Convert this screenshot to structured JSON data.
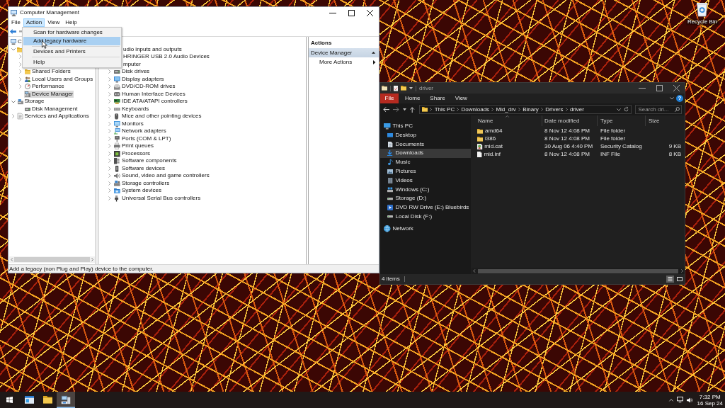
{
  "desktop": {
    "recycle_bin": {
      "label": "Recycle Bin"
    }
  },
  "computer_management": {
    "title": "Computer Management",
    "menu_bar": [
      {
        "label": "File",
        "selected": false
      },
      {
        "label": "Action",
        "selected": true
      },
      {
        "label": "View",
        "selected": false
      },
      {
        "label": "Help",
        "selected": false
      }
    ],
    "action_menu": [
      {
        "kind": "item",
        "label": "Scan for hardware changes",
        "selected": false
      },
      {
        "kind": "item",
        "label": "Add legacy hardware",
        "selected": true
      },
      {
        "kind": "separator"
      },
      {
        "kind": "item",
        "label": "Devices and Printers",
        "selected": false
      },
      {
        "kind": "separator"
      },
      {
        "kind": "item",
        "label": "Help",
        "selected": false
      }
    ],
    "console_tree": [
      {
        "kind": "computer",
        "label": "C",
        "selected": false,
        "children": [
          {
            "kind": "tools",
            "expanded": true,
            "children": [
              {
                "kind": "covered",
                "expanded": false
              },
              {
                "kind": "covered",
                "expanded": false
              },
              {
                "kind": "shared",
                "label": "Shared Folders",
                "expanded": false,
                "selected": false
              },
              {
                "kind": "users",
                "label": "Local Users and Groups",
                "expanded": false,
                "selected": false
              },
              {
                "kind": "performance",
                "label": "Performance",
                "expanded": false,
                "selected": false
              },
              {
                "kind": "device_manager",
                "label": "Device Manager",
                "selected": true
              }
            ]
          },
          {
            "kind": "storage",
            "label": "Storage",
            "expanded": true,
            "selected": false,
            "children": [
              {
                "kind": "disk",
                "label": "Disk Management",
                "selected": false
              }
            ]
          },
          {
            "kind": "services",
            "label": "Services and Applications",
            "expanded": false,
            "selected": false
          }
        ]
      }
    ],
    "device_tree": [
      {
        "kind": "covered",
        "label": "udio inputs and outputs"
      },
      {
        "kind": "covered",
        "label": "HRINGER USB 2.0 Audio Devices"
      },
      {
        "kind": "covered",
        "label": "mputer"
      },
      {
        "kind": "disk",
        "label": "Disk drives",
        "expanded": false
      },
      {
        "kind": "display",
        "label": "Display adapters",
        "expanded": false
      },
      {
        "kind": "optical",
        "label": "DVD/CD-ROM drives",
        "expanded": false
      },
      {
        "kind": "hid",
        "label": "Human Interface Devices",
        "expanded": false
      },
      {
        "kind": "ide",
        "label": "IDE ATA/ATAPI controllers",
        "expanded": false
      },
      {
        "kind": "keyboard",
        "label": "Keyboards",
        "expanded": false
      },
      {
        "kind": "mouse",
        "label": "Mice and other pointing devices",
        "expanded": false
      },
      {
        "kind": "monitor",
        "label": "Monitors",
        "expanded": false
      },
      {
        "kind": "network",
        "label": "Network adapters",
        "expanded": false
      },
      {
        "kind": "port",
        "label": "Ports (COM & LPT)",
        "expanded": false
      },
      {
        "kind": "printer",
        "label": "Print queues",
        "expanded": false
      },
      {
        "kind": "processor",
        "label": "Processors",
        "expanded": false
      },
      {
        "kind": "software_component",
        "label": "Software components",
        "expanded": false
      },
      {
        "kind": "software_device",
        "label": "Software devices",
        "expanded": false
      },
      {
        "kind": "sound",
        "label": "Sound, video and game controllers",
        "expanded": false
      },
      {
        "kind": "storage",
        "label": "Storage controllers",
        "expanded": false
      },
      {
        "kind": "system",
        "label": "System devices",
        "expanded": false
      },
      {
        "kind": "usb",
        "label": "Universal Serial Bus controllers",
        "expanded": false
      }
    ],
    "actions": {
      "title": "Actions",
      "sections": [
        {
          "label": "Device Manager",
          "expanded": true,
          "items": [
            {
              "label": "More Actions"
            }
          ]
        }
      ]
    },
    "status_bar": "Add a legacy (non Plug and Play) device to the computer."
  },
  "file_explorer": {
    "title": "driver",
    "ribbon_tabs": [
      {
        "kind": "file",
        "label": "File"
      },
      {
        "kind": "tab",
        "label": "Home"
      },
      {
        "kind": "tab",
        "label": "Share"
      },
      {
        "kind": "tab",
        "label": "View"
      }
    ],
    "help_button": "?",
    "address": [
      "This PC",
      "Downloads",
      "Mid_drv",
      "Binary",
      "Drivers",
      "driver"
    ],
    "search": {
      "placeholder": "Search dri..."
    },
    "navigation": [
      {
        "kind": "pc",
        "label": "This PC",
        "selected": false,
        "children": [
          {
            "kind": "desktop",
            "label": "Desktop",
            "selected": false
          },
          {
            "kind": "documents",
            "label": "Documents",
            "selected": false
          },
          {
            "kind": "downloads",
            "label": "Downloads",
            "selected": true
          },
          {
            "kind": "music",
            "label": "Music",
            "selected": false
          },
          {
            "kind": "pictures",
            "label": "Pictures",
            "selected": false
          },
          {
            "kind": "videos",
            "label": "Videos",
            "selected": false
          },
          {
            "kind": "system_drive",
            "label": "Windows (C:)",
            "selected": false
          },
          {
            "kind": "drive",
            "label": "Storage (D:)",
            "selected": false
          },
          {
            "kind": "dvd",
            "label": "DVD RW Drive (E:) Bluebirds",
            "selected": false
          },
          {
            "kind": "drive",
            "label": "Local Disk (F:)",
            "selected": false
          }
        ]
      },
      {
        "kind": "network",
        "label": "Network",
        "selected": false
      }
    ],
    "columns": [
      {
        "label": "Name",
        "sorted": true
      },
      {
        "label": "Date modified",
        "sorted": false
      },
      {
        "label": "Type",
        "sorted": false
      },
      {
        "label": "Size",
        "sorted": false
      }
    ],
    "files": [
      {
        "kind": "folder",
        "name": "amd64",
        "modified": "8 Nov 12 4:08 PM",
        "type": "File folder"
      },
      {
        "kind": "folder",
        "name": "i386",
        "modified": "8 Nov 12 4:08 PM",
        "type": "File folder"
      },
      {
        "kind": "catalog",
        "name": "mid.cat",
        "modified": "30 Aug 06 4:40 PM",
        "type": "Security Catalog",
        "size": "9 KB"
      },
      {
        "kind": "document",
        "name": "mid.inf",
        "modified": "8 Nov 12 4:08 PM",
        "type": "INF File",
        "size": "8 KB"
      }
    ],
    "status": "4 items",
    "views": [
      {
        "kind": "details",
        "selected": true
      },
      {
        "kind": "large_icons",
        "selected": false
      }
    ]
  },
  "taskbar": {
    "apps": [
      {
        "kind": "console",
        "selected": false
      },
      {
        "kind": "explorer",
        "selected": false
      },
      {
        "kind": "device",
        "selected": true
      }
    ],
    "clock": {
      "time": "7:32 PM",
      "date": "16 Sep 24"
    }
  }
}
